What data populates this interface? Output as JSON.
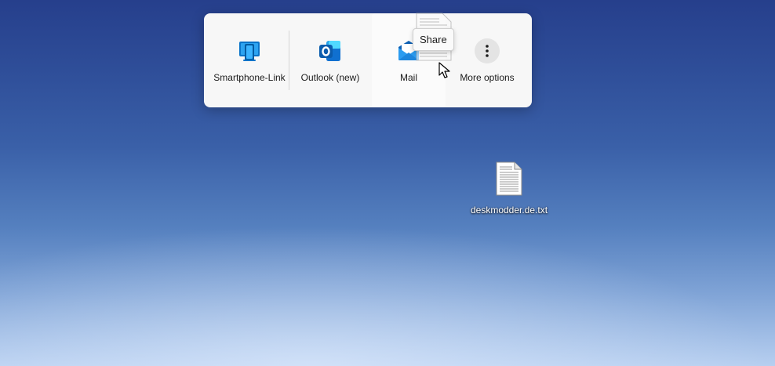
{
  "share_flyout": {
    "items": [
      {
        "label": "Smartphone-Link",
        "icon": "phone-link-icon"
      },
      {
        "label": "Outlook (new)",
        "icon": "outlook-icon"
      },
      {
        "label": "Mail",
        "icon": "mail-icon"
      },
      {
        "label": "More options",
        "icon": "more-options-icon"
      }
    ]
  },
  "tooltip": {
    "text": "Share"
  },
  "desktop": {
    "file": {
      "name": "deskmodder.de.txt",
      "icon": "text-file-icon"
    }
  },
  "colors": {
    "accent": "#0f6cbd",
    "panel_bg": "#f7f7f7"
  }
}
